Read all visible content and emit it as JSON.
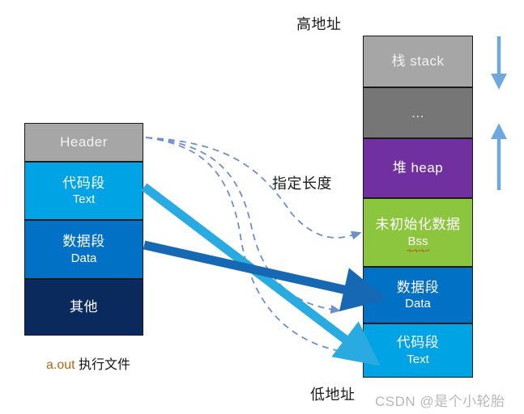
{
  "diagram": {
    "title_high_address": "高地址",
    "title_low_address": "低地址",
    "middle_label": "指定长度",
    "file_caption_name": "a.out",
    "file_caption_text": "执行文件",
    "watermark": "CSDN @是个小轮胎"
  },
  "file_blocks": [
    {
      "cn": "Header",
      "en": "",
      "color": "#a6a6a6",
      "text_color": "#f2f2f2",
      "single": true
    },
    {
      "cn": "代码段",
      "en": "Text",
      "color": "#00A4E4",
      "text_color": "#ffffff",
      "single": false
    },
    {
      "cn": "数据段",
      "en": "Data",
      "color": "#0071C5",
      "text_color": "#ffffff",
      "single": false
    },
    {
      "cn": "其他",
      "en": "",
      "color": "#0A2A5E",
      "text_color": "#ffffff",
      "single": true
    }
  ],
  "memory_blocks": [
    {
      "cn": "栈 stack",
      "en": "",
      "color": "#a6a6a6",
      "text_color": "#f2f2f2",
      "single": true
    },
    {
      "cn": "...",
      "en": "",
      "color": "#767676",
      "text_color": "#e6e6e6",
      "single": true
    },
    {
      "cn": "堆 heap",
      "en": "",
      "color": "#7030A0",
      "text_color": "#ffffff",
      "single": true
    },
    {
      "cn": "未初始化数据",
      "en": "Bss",
      "color": "#8CC63F",
      "text_color": "#ffffff",
      "single": false,
      "misspelled": true
    },
    {
      "cn": "数据段",
      "en": "Data",
      "color": "#0071C5",
      "text_color": "#ffffff",
      "single": false
    },
    {
      "cn": "代码段",
      "en": "Text",
      "color": "#00A4E4",
      "text_color": "#ffffff",
      "single": false
    }
  ],
  "arrows": {
    "solid_text_mapping": "代码段 Text 映射箭头",
    "solid_data_mapping": "数据段 Data 映射箭头",
    "dashed_bss_mapping": "Header 指定长度 虚线箭头",
    "stack_growth_down": "栈向下增长箭头",
    "heap_growth_up": "堆向上增长箭头"
  },
  "colors": {
    "light_blue_arrow": "#29ABE2",
    "dark_blue_arrow": "#1668B3",
    "dashed_arrow": "#6E8FC9",
    "growth_arrow": "#6FA8DC"
  }
}
